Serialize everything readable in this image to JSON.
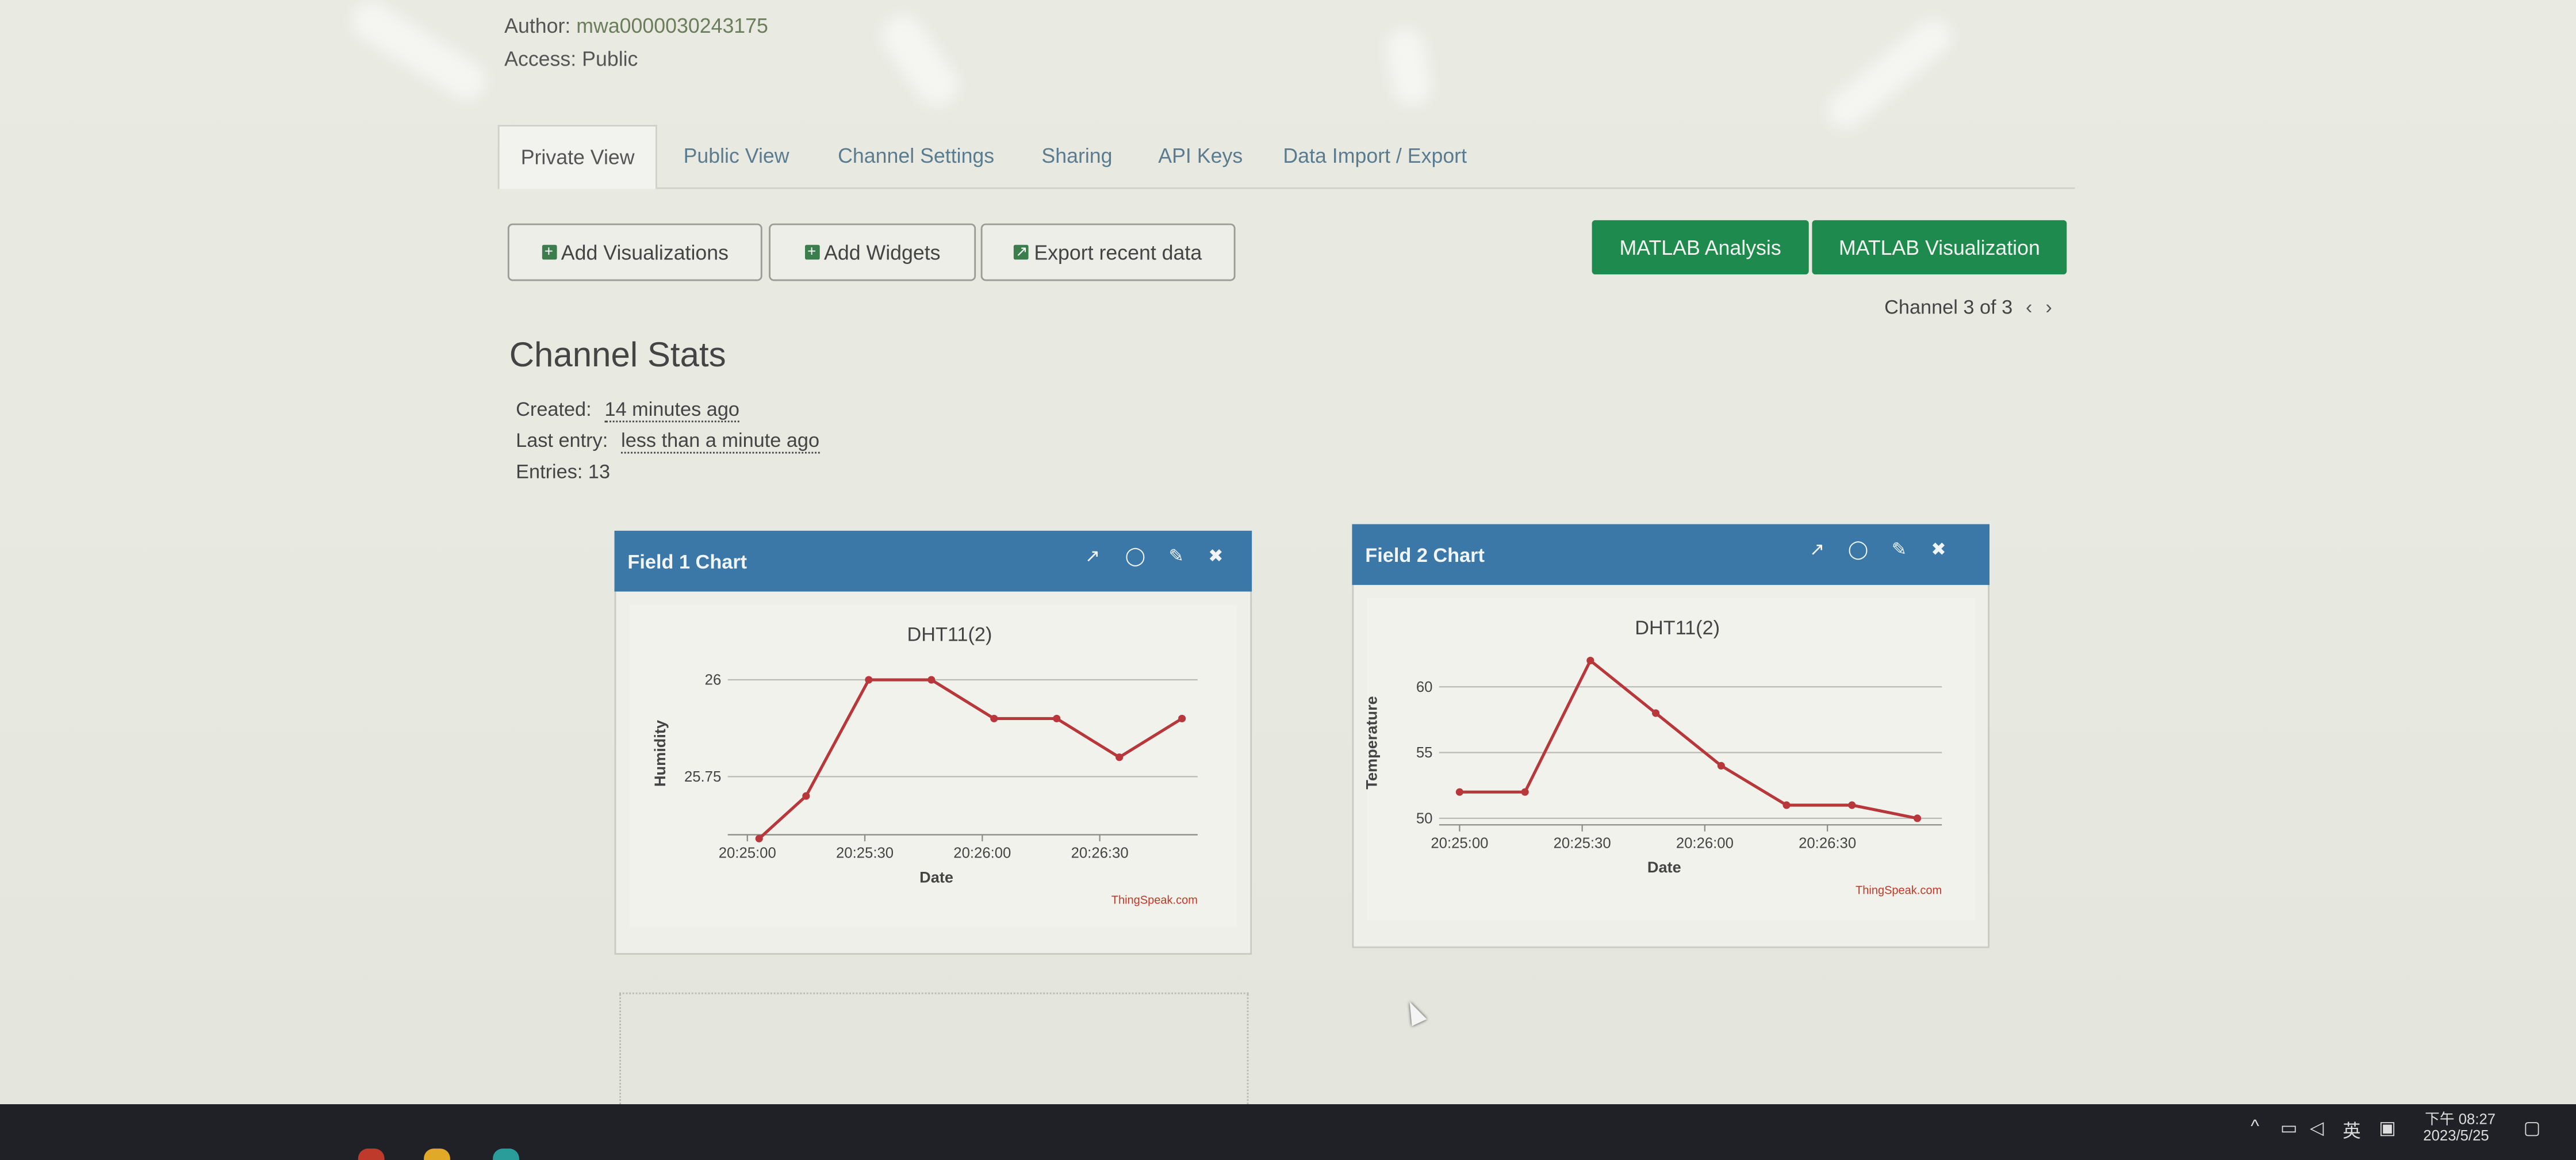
{
  "channel": {
    "author_label": "Author:",
    "author_value": "mwa0000030243175",
    "access_label": "Access:",
    "access_value": "Public"
  },
  "tabs": [
    {
      "label": "Private View",
      "active": true
    },
    {
      "label": "Public View"
    },
    {
      "label": "Channel Settings"
    },
    {
      "label": "Sharing"
    },
    {
      "label": "API Keys"
    },
    {
      "label": "Data Import / Export"
    }
  ],
  "toolbar": {
    "add_visualizations": "Add Visualizations",
    "add_widgets": "Add Widgets",
    "export_recent": "Export recent data",
    "matlab_analysis": "MATLAB Analysis",
    "matlab_visualization": "MATLAB Visualization",
    "channel_nav": "Channel 3 of 3",
    "prev": "‹",
    "next": "›"
  },
  "stats": {
    "title": "Channel Stats",
    "created_label": "Created:",
    "created_value": "14 minutes ago",
    "last_entry_label": "Last entry:",
    "last_entry_value": "less than a minute ago",
    "entries": "Entries: 13"
  },
  "widget_icons": {
    "open": "↗",
    "comment": "◯",
    "edit": "✎",
    "close": "✖"
  },
  "chart_data": [
    {
      "widget_title": "Field 1 Chart",
      "type": "line",
      "title": "DHT11(2)",
      "xlabel": "Date",
      "ylabel": "Humidity",
      "credit": "ThingSpeak.com",
      "x_ticks": [
        "20:25:00",
        "20:25:30",
        "20:26:00",
        "20:26:30"
      ],
      "y_ticks": [
        25.75,
        26
      ],
      "x_range": [
        "20:24:55",
        "20:26:55"
      ],
      "ylim": [
        25.6,
        26.02
      ],
      "series": [
        {
          "color": "#b8373a",
          "points": [
            {
              "x": "20:25:03",
              "y": 25.59
            },
            {
              "x": "20:25:15",
              "y": 25.7
            },
            {
              "x": "20:25:31",
              "y": 26.0
            },
            {
              "x": "20:25:47",
              "y": 26.0
            },
            {
              "x": "20:26:03",
              "y": 25.9
            },
            {
              "x": "20:26:19",
              "y": 25.9
            },
            {
              "x": "20:26:35",
              "y": 25.8
            },
            {
              "x": "20:26:51",
              "y": 25.9
            }
          ]
        }
      ]
    },
    {
      "widget_title": "Field 2 Chart",
      "type": "line",
      "title": "DHT11(2)",
      "xlabel": "Date",
      "ylabel": "Temperature",
      "credit": "ThingSpeak.com",
      "x_ticks": [
        "20:25:00",
        "20:25:30",
        "20:26:00",
        "20:26:30"
      ],
      "y_ticks": [
        50,
        55,
        60
      ],
      "x_range": [
        "20:24:55",
        "20:26:58"
      ],
      "ylim": [
        49.5,
        62
      ],
      "series": [
        {
          "color": "#b8373a",
          "points": [
            {
              "x": "20:25:00",
              "y": 52
            },
            {
              "x": "20:25:16",
              "y": 52
            },
            {
              "x": "20:25:32",
              "y": 62
            },
            {
              "x": "20:25:48",
              "y": 58
            },
            {
              "x": "20:26:04",
              "y": 54
            },
            {
              "x": "20:26:20",
              "y": 51
            },
            {
              "x": "20:26:36",
              "y": 51
            },
            {
              "x": "20:26:52",
              "y": 50
            }
          ]
        }
      ]
    }
  ],
  "taskbar": {
    "tray_chevron": "^",
    "tray_lang": "英",
    "clock_time": "下午 08:27",
    "clock_date": "2023/5/25"
  }
}
